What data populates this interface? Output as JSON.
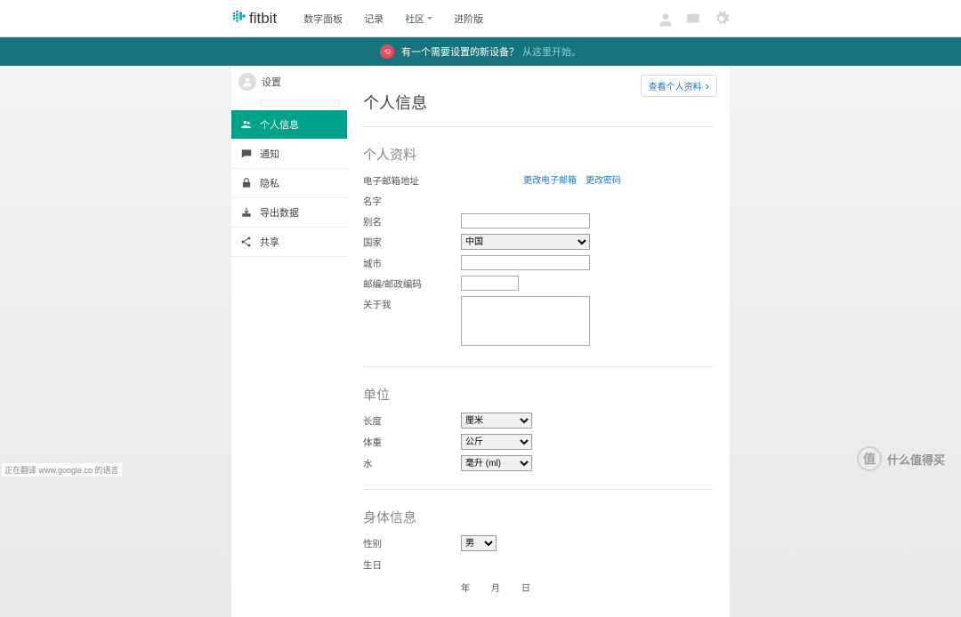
{
  "brand": "fitbit",
  "nav": {
    "dashboard": "数字面板",
    "log": "记录",
    "community": "社区",
    "premium": "进阶版"
  },
  "alert": {
    "text": "有一个需要设置的新设备？",
    "link": "从这里开始。"
  },
  "user": {
    "settings_label": "设置"
  },
  "view_profile": "查看个人资料",
  "sidebar": {
    "personal": "个人信息",
    "notify": "通知",
    "privacy": "隐私",
    "export": "导出数据",
    "share": "共享"
  },
  "page_title": "个人信息",
  "sections": {
    "profile": {
      "title": "个人资料",
      "email_label": "电子邮箱地址",
      "change_email": "更改电子邮箱",
      "change_password": "更改密码",
      "name_label": "名字",
      "nickname_label": "别名",
      "country_label": "国家",
      "country_value": "中国",
      "city_label": "城市",
      "postal_label": "邮编/邮政编码",
      "about_label": "关于我"
    },
    "units": {
      "title": "单位",
      "length_label": "长度",
      "length_value": "厘米",
      "weight_label": "体重",
      "weight_value": "公斤",
      "water_label": "水",
      "water_value": "毫升 (ml)"
    },
    "body": {
      "title": "身体信息",
      "gender_label": "性别",
      "gender_value": "男",
      "birthday_label": "生日",
      "year": "年",
      "month": "月",
      "day": "日"
    }
  },
  "footer_status": "正在翻译 www.google.co 的语言",
  "watermark": {
    "badge": "值",
    "text": "什么值得买"
  }
}
